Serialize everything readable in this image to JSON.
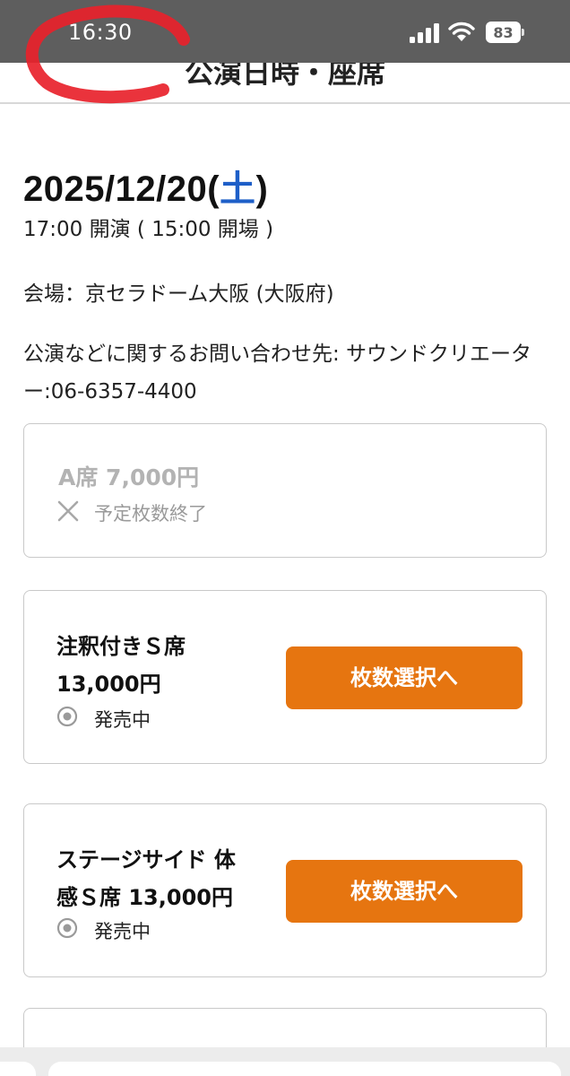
{
  "status_bar": {
    "time": "16:30",
    "battery": "83",
    "icons": [
      "signal-icon",
      "wifi-icon",
      "battery-icon"
    ]
  },
  "header": {
    "title": "公演日時・座席"
  },
  "performance": {
    "date_main": "2025/12/20(",
    "weekday": "土",
    "date_close": ")",
    "time": "17:00 開演 ( 15:00 開場 )",
    "venue": "会場：京セラドーム大阪 (大阪府)",
    "contact": "公演などに関するお問い合わせ先: サウンドクリエーター:06-6357-4400"
  },
  "seats": [
    {
      "name": "A席 7,000円",
      "status": "予定枚数終了",
      "status_icon": "x-icon"
    },
    {
      "name_line1": "注釈付きＳ席",
      "name_line2": "13,000円",
      "status": "発売中",
      "status_icon": "circle-icon",
      "button_label": "枚数選択へ"
    },
    {
      "name_line1": "ステージサイド 体",
      "name_line2": "感Ｓ席 13,000円",
      "status": "発売中",
      "status_icon": "circle-icon",
      "button_label": "枚数選択へ"
    }
  ],
  "colors": {
    "accent_button": "#e67510",
    "saturday": "#1e5fc8",
    "status_bar": "#5e5e5e",
    "annotation": "#e8222b"
  }
}
